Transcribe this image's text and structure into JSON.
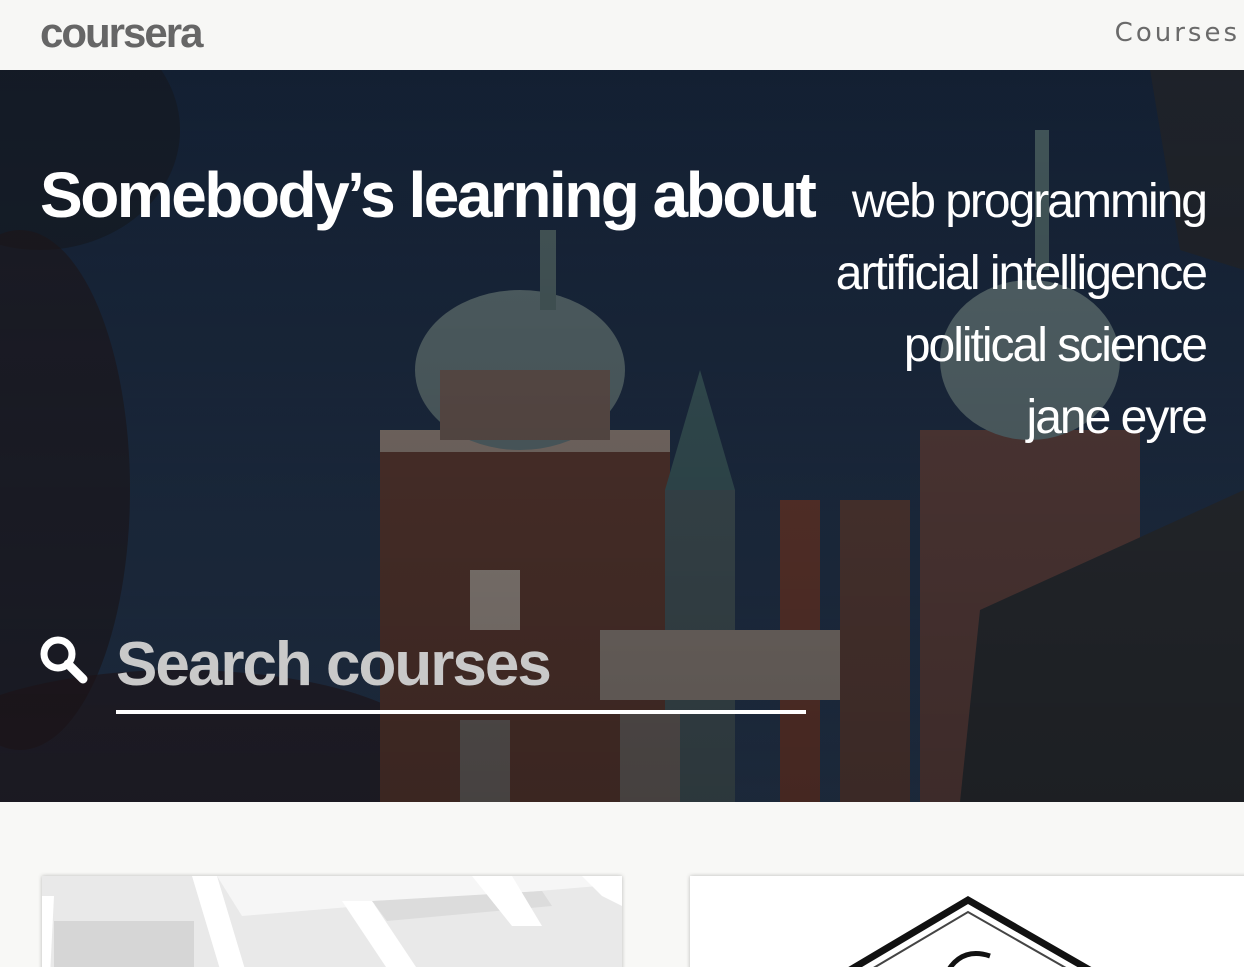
{
  "header": {
    "logo_text": "coursera",
    "nav_courses_label": "Courses"
  },
  "hero": {
    "title": "Somebody’s learning about",
    "topics": [
      {
        "label": "web programming"
      },
      {
        "label": "artificial intelligence"
      },
      {
        "label": "political science"
      },
      {
        "label": "jane eyre"
      }
    ],
    "search": {
      "placeholder": "Search courses",
      "value": ""
    }
  },
  "colors": {
    "header_bg": "#f7f7f5",
    "logo": "#666666",
    "hero_sky": "#1c2c44",
    "hero_text": "#ffffff",
    "placeholder": "#c9c9c9"
  }
}
